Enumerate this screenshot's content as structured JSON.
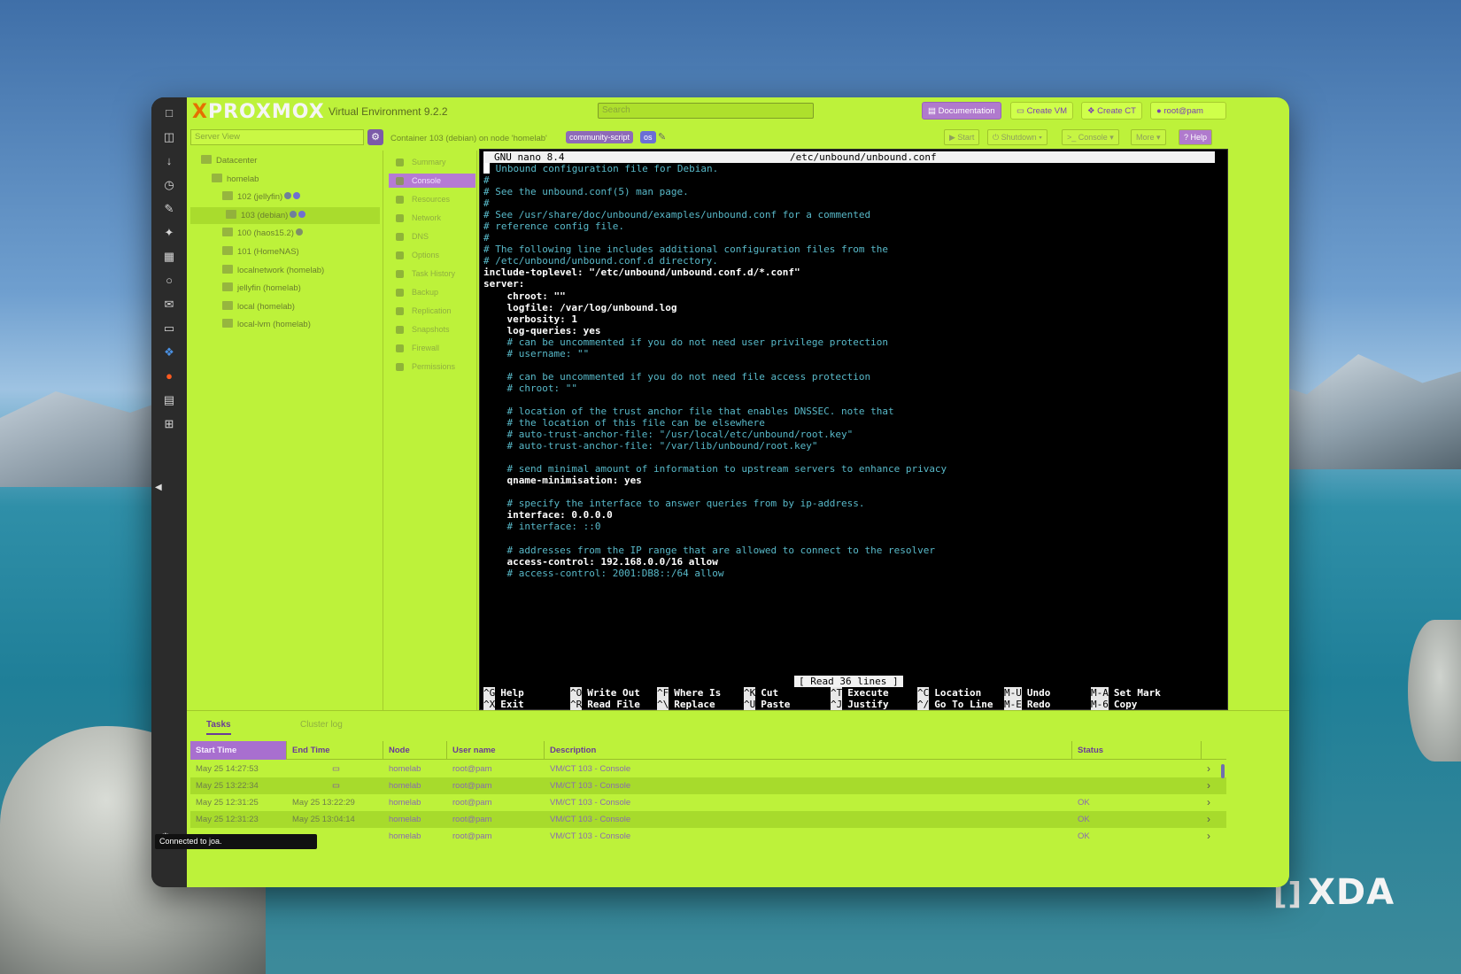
{
  "app": {
    "logo_text": "PROXMOX",
    "version": "Virtual Environment 9.2.2",
    "search_placeholder": "Search"
  },
  "header_buttons": {
    "documentation": "Documentation",
    "create_vm": "Create VM",
    "create_ct": "Create CT",
    "user": "root@pam"
  },
  "toolbar": {
    "view_select": "Server View",
    "container_title": "Container 103 (debian) on node 'homelab'",
    "tag_community": "community-script",
    "tag_os": "os",
    "start": "Start",
    "shutdown": "Shutdown",
    "console": "Console",
    "more": "More",
    "help": "Help"
  },
  "tree": [
    {
      "label": "Datacenter",
      "indent": 0
    },
    {
      "label": "homelab",
      "indent": 1
    },
    {
      "label": "102 (jellyfin)",
      "indent": 2
    },
    {
      "label": "103 (debian)",
      "indent": 2,
      "selected": true
    },
    {
      "label": "100 (haos15.2)",
      "indent": 2
    },
    {
      "label": "101 (HomeNAS)",
      "indent": 2
    },
    {
      "label": "localnetwork (homelab)",
      "indent": 2
    },
    {
      "label": "jellyfin (homelab)",
      "indent": 2
    },
    {
      "label": "local (homelab)",
      "indent": 2
    },
    {
      "label": "local-lvm (homelab)",
      "indent": 2
    }
  ],
  "side_menu": [
    "Summary",
    "Console",
    "Resources",
    "Network",
    "DNS",
    "Options",
    "Task History",
    "Backup",
    "Replication",
    "Snapshots",
    "Firewall",
    "Permissions"
  ],
  "terminal": {
    "nano_version": "GNU nano 8.4",
    "file_path": "/etc/unbound/unbound.conf",
    "lines": [
      {
        "t": " Unbound configuration file for Debian.",
        "s": "c",
        "cursor": true
      },
      {
        "t": "#",
        "s": "c"
      },
      {
        "t": "# See the unbound.conf(5) man page.",
        "s": "c"
      },
      {
        "t": "#",
        "s": "c"
      },
      {
        "t": "# See /usr/share/doc/unbound/examples/unbound.conf for a commented",
        "s": "c"
      },
      {
        "t": "# reference config file.",
        "s": "c"
      },
      {
        "t": "#",
        "s": "c"
      },
      {
        "t": "# The following line includes additional configuration files from the",
        "s": "c"
      },
      {
        "t": "# /etc/unbound/unbound.conf.d directory.",
        "s": "c"
      },
      {
        "t": "include-toplevel: \"/etc/unbound/unbound.conf.d/*.conf\"",
        "s": "w"
      },
      {
        "t": "server:",
        "s": "w"
      },
      {
        "t": "    chroot: \"\"",
        "s": "w"
      },
      {
        "t": "    logfile: /var/log/unbound.log",
        "s": "w"
      },
      {
        "t": "    verbosity: 1",
        "s": "w"
      },
      {
        "t": "    log-queries: yes",
        "s": "w"
      },
      {
        "t": "    # can be uncommented if you do not need user privilege protection",
        "s": "c"
      },
      {
        "t": "    # username: \"\"",
        "s": "c"
      },
      {
        "t": "",
        "s": "c"
      },
      {
        "t": "    # can be uncommented if you do not need file access protection",
        "s": "c"
      },
      {
        "t": "    # chroot: \"\"",
        "s": "c"
      },
      {
        "t": "",
        "s": "c"
      },
      {
        "t": "    # location of the trust anchor file that enables DNSSEC. note that",
        "s": "c"
      },
      {
        "t": "    # the location of this file can be elsewhere",
        "s": "c"
      },
      {
        "t": "    # auto-trust-anchor-file: \"/usr/local/etc/unbound/root.key\"",
        "s": "c"
      },
      {
        "t": "    # auto-trust-anchor-file: \"/var/lib/unbound/root.key\"",
        "s": "c"
      },
      {
        "t": "",
        "s": "c"
      },
      {
        "t": "    # send minimal amount of information to upstream servers to enhance privacy",
        "s": "c"
      },
      {
        "t": "    qname-minimisation: yes",
        "s": "w"
      },
      {
        "t": "",
        "s": "c"
      },
      {
        "t": "    # specify the interface to answer queries from by ip-address.",
        "s": "c"
      },
      {
        "t": "    interface: 0.0.0.0",
        "s": "w"
      },
      {
        "t": "    # interface: ::0",
        "s": "c"
      },
      {
        "t": "",
        "s": "c"
      },
      {
        "t": "    # addresses from the IP range that are allowed to connect to the resolver",
        "s": "c"
      },
      {
        "t": "    access-control: 192.168.0.0/16 allow",
        "s": "w"
      },
      {
        "t": "    # access-control: 2001:DB8::/64 allow",
        "s": "c"
      }
    ],
    "status_message": "[ Read 36 lines ]",
    "shortcuts_row1": [
      {
        "k": "^G",
        "l": "Help"
      },
      {
        "k": "^O",
        "l": "Write Out"
      },
      {
        "k": "^F",
        "l": "Where Is"
      },
      {
        "k": "^K",
        "l": "Cut"
      },
      {
        "k": "^T",
        "l": "Execute"
      },
      {
        "k": "^C",
        "l": "Location"
      },
      {
        "k": "M-U",
        "l": "Undo"
      },
      {
        "k": "M-A",
        "l": "Set Mark"
      }
    ],
    "shortcuts_row2": [
      {
        "k": "^X",
        "l": "Exit"
      },
      {
        "k": "^R",
        "l": "Read File"
      },
      {
        "k": "^\\",
        "l": "Replace"
      },
      {
        "k": "^U",
        "l": "Paste"
      },
      {
        "k": "^J",
        "l": "Justify"
      },
      {
        "k": "^/",
        "l": "Go To Line"
      },
      {
        "k": "M-E",
        "l": "Redo"
      },
      {
        "k": "M-6",
        "l": "Copy"
      }
    ]
  },
  "bottom_tabs": {
    "tasks": "Tasks",
    "cluster_log": "Cluster log"
  },
  "tasks_table": {
    "headers": [
      "Start Time",
      "End Time",
      "Node",
      "User name",
      "Description",
      "Status"
    ],
    "rows": [
      {
        "start": "May 25 14:27:53",
        "end": "",
        "running": true,
        "node": "homelab",
        "user": "root@pam",
        "desc": "VM/CT 103 - Console",
        "status": ""
      },
      {
        "start": "May 25 13:22:34",
        "end": "",
        "running": true,
        "node": "homelab",
        "user": "root@pam",
        "desc": "VM/CT 103 - Console",
        "status": ""
      },
      {
        "start": "May 25 12:31:25",
        "end": "May 25 13:22:29",
        "running": false,
        "node": "homelab",
        "user": "root@pam",
        "desc": "VM/CT 103 - Console",
        "status": "OK"
      },
      {
        "start": "May 25 12:31:23",
        "end": "May 25 13:04:14",
        "running": false,
        "node": "homelab",
        "user": "root@pam",
        "desc": "VM/CT 103 - Console",
        "status": "OK"
      },
      {
        "start": "",
        "end": "",
        "running": false,
        "node": "homelab",
        "user": "root@pam",
        "desc": "VM/CT 103 - Console",
        "status": "OK"
      }
    ]
  },
  "toast": "Connected to joa.",
  "watermark": "XDA",
  "colors": {
    "accent_green": "#bdf23a",
    "accent_purple": "#a86fcf",
    "terminal_comment": "#58b9c9"
  }
}
